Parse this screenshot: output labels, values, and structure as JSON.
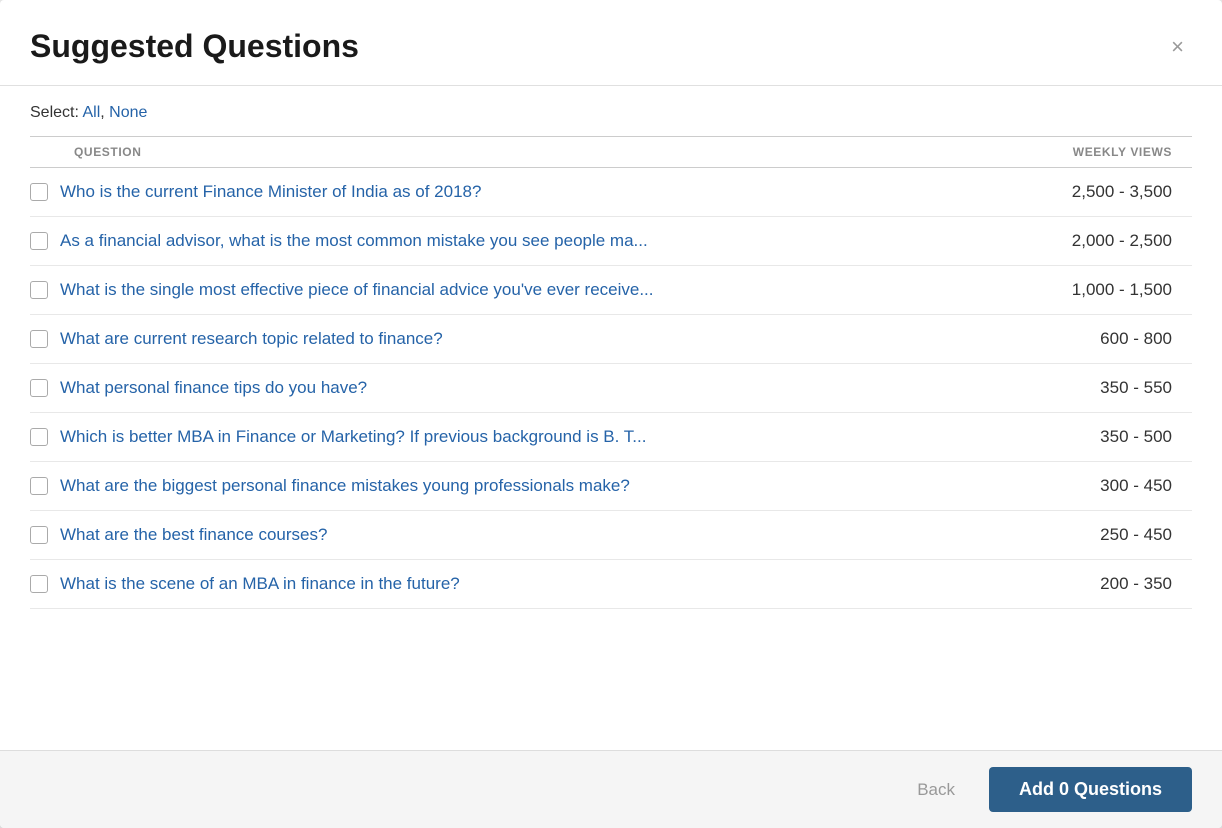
{
  "modal": {
    "title": "Suggested Questions",
    "close_label": "×"
  },
  "select": {
    "label": "Select:",
    "all_label": "All",
    "none_label": "None"
  },
  "table": {
    "col_question": "QUESTION",
    "col_views": "WEEKLY VIEWS"
  },
  "questions": [
    {
      "text": "Who is the current Finance Minister of India as of 2018?",
      "views": "2,500 - 3,500",
      "checked": false
    },
    {
      "text": "As a financial advisor, what is the most common mistake you see people ma...",
      "views": "2,000 - 2,500",
      "checked": false
    },
    {
      "text": "What is the single most effective piece of financial advice you've ever receive...",
      "views": "1,000 - 1,500",
      "checked": false
    },
    {
      "text": "What are current research topic related to finance?",
      "views": "600 - 800",
      "checked": false
    },
    {
      "text": "What personal finance tips do you have?",
      "views": "350 - 550",
      "checked": false
    },
    {
      "text": "Which is better MBA in Finance or Marketing? If previous background is B. T...",
      "views": "350 - 500",
      "checked": false
    },
    {
      "text": "What are the biggest personal finance mistakes young professionals make?",
      "views": "300 - 450",
      "checked": false
    },
    {
      "text": "What are the best finance courses?",
      "views": "250 - 450",
      "checked": false
    },
    {
      "text": "What is the scene of an MBA in finance in the future?",
      "views": "200 - 350",
      "checked": false
    }
  ],
  "footer": {
    "back_label": "Back",
    "add_label": "Add 0 Questions"
  }
}
